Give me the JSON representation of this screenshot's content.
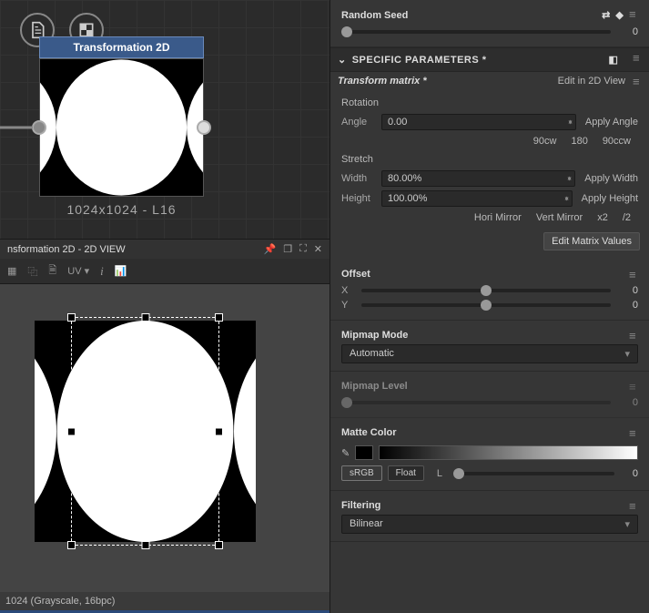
{
  "graph": {
    "node_title": "Transformation 2D",
    "node_info": "1024x1024 - L16"
  },
  "view": {
    "title": "nsformation 2D - 2D VIEW",
    "uv_label": "UV",
    "status": "1024 (Grayscale, 16bpc)"
  },
  "panel": {
    "random_seed": {
      "label": "Random Seed",
      "value": "0"
    },
    "specific_header": "SPECIFIC PARAMETERS *",
    "transform_matrix": {
      "label": "Transform matrix *",
      "edit_link": "Edit in 2D View"
    },
    "rotation": {
      "label": "Rotation",
      "angle_label": "Angle",
      "angle_value": "0.00",
      "apply_angle": "Apply Angle",
      "cw90": "90cw",
      "r180": "180",
      "ccw90": "90ccw"
    },
    "stretch": {
      "label": "Stretch",
      "width_label": "Width",
      "width_value": "80.00%",
      "apply_width": "Apply Width",
      "height_label": "Height",
      "height_value": "100.00%",
      "apply_height": "Apply Height",
      "hori": "Hori Mirror",
      "vert": "Vert Mirror",
      "x2": "x2",
      "d2": "/2"
    },
    "edit_matrix": "Edit Matrix Values",
    "offset": {
      "label": "Offset",
      "x": "X",
      "y": "Y",
      "xv": "0",
      "yv": "0"
    },
    "mipmap_mode": {
      "label": "Mipmap Mode",
      "value": "Automatic"
    },
    "mipmap_level": {
      "label": "Mipmap Level",
      "value": "0"
    },
    "matte_color": {
      "label": "Matte Color",
      "srgb": "sRGB",
      "float": "Float",
      "l": "L",
      "lv": "0"
    },
    "filtering": {
      "label": "Filtering",
      "value": "Bilinear"
    }
  }
}
